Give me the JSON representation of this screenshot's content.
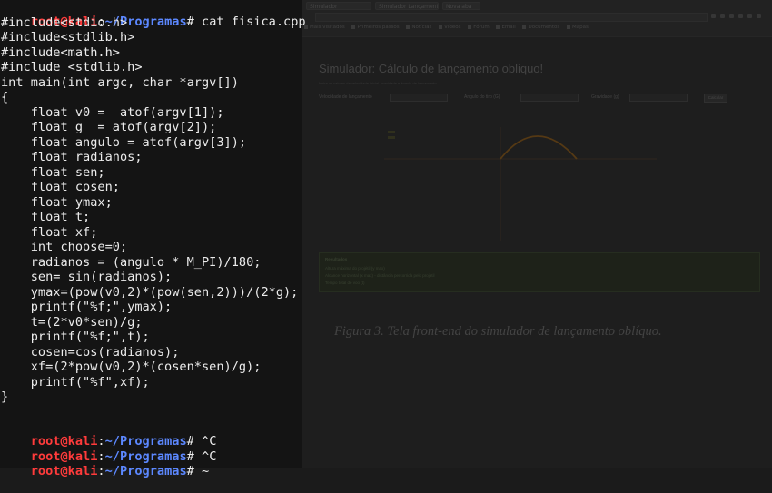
{
  "browser": {
    "tabs": [
      "Simulador",
      "Simulador Lançamento",
      "Nova aba"
    ],
    "bookmarks": [
      "Mais visitados",
      "Primeiros passos",
      "Notícias",
      "Vídeos",
      "Fórum",
      "Email",
      "Documentos",
      "Mapas"
    ]
  },
  "simulator": {
    "title": "Simulador: Cálculo de lançamento obliquo!",
    "subtitle": "Insira os valores da velocidade inicial, gravidade e ângulo de lançamento",
    "fields": [
      {
        "label": "Velocidade de lançamento",
        "placeholder": ""
      },
      {
        "label": "Ângulo do tiro (G)",
        "placeholder": ""
      },
      {
        "label": "Gravidade (g)",
        "placeholder": ""
      }
    ],
    "calc_button": "Calcular",
    "results": {
      "title": "Resultados",
      "lines": [
        "Altura máxima do projétil (y max)",
        "Alcance horizontal (x max) - distância percorrida pelo projétil",
        "Tempo total de voo (t)"
      ]
    }
  },
  "caption": "Figura 3. Tela front-end do simulador de lançamento oblíquo.",
  "terminal": {
    "prompt": {
      "user": "root@kali",
      "colon": ":",
      "path": "~/Programas",
      "symbol": "#"
    },
    "command": " cat fisica.cpp",
    "code_lines": [
      "#include<stdio.h>",
      "#include<stdlib.h>",
      "#include<math.h>",
      "#include <stdlib.h>",
      "int main(int argc, char *argv[])",
      "{",
      "    float v0 =  atof(argv[1]);",
      "    float g  = atof(argv[2]);",
      "    float angulo = atof(argv[3]);",
      "    float radianos;",
      "    float sen;",
      "    float cosen;",
      "    float ymax;",
      "    float t;",
      "    float xf;",
      "    int choose=0;",
      "    radianos = (angulo * M_PI)/180;",
      "    sen= sin(radianos);",
      "    ymax=(pow(v0,2)*(pow(sen,2)))/(2*g);",
      "    printf(\"%f;\",ymax);",
      "    t=(2*v0*sen)/g;",
      "    printf(\"%f;\",t);",
      "    cosen=cos(radianos);",
      "    xf=(2*pow(v0,2)*(cosen*sen)/g);",
      "    printf(\"%f\",xf);",
      "}",
      ""
    ],
    "after_prompts": [
      " ^C",
      " ^C",
      " ~"
    ]
  },
  "colors": {
    "prompt_user": "#ff3b3b",
    "prompt_path": "#5c88ff",
    "terminal_text": "#ececec",
    "curve": "#8a5a1a"
  }
}
